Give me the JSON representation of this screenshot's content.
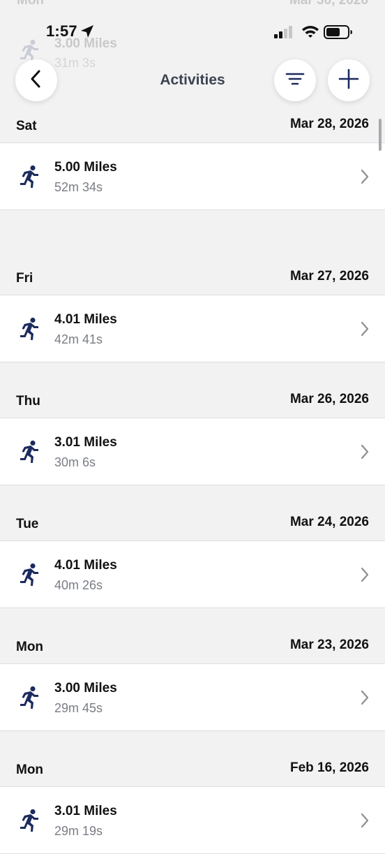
{
  "status_bar": {
    "time": "1:57"
  },
  "ghost_row": {
    "day": "Mon",
    "date": "Mar 30, 2026",
    "miles": "3.00 Miles",
    "duration": "31m 3s"
  },
  "nav": {
    "title": "Activities"
  },
  "colors": {
    "accent": "#1c2b5e",
    "background": "#f2f2f3",
    "card": "#ffffff",
    "muted_text": "#7a7d84"
  },
  "activities": [
    {
      "day": "Sat",
      "date": "Mar 28, 2026",
      "miles": "5.00 Miles",
      "duration": "52m 34s",
      "icon": "running-icon"
    },
    {
      "day": "Fri",
      "date": "Mar 27, 2026",
      "miles": "4.01 Miles",
      "duration": "42m 41s",
      "icon": "running-icon"
    },
    {
      "day": "Thu",
      "date": "Mar 26, 2026",
      "miles": "3.01 Miles",
      "duration": "30m 6s",
      "icon": "running-icon"
    },
    {
      "day": "Tue",
      "date": "Mar 24, 2026",
      "miles": "4.01 Miles",
      "duration": "40m 26s",
      "icon": "running-icon"
    },
    {
      "day": "Mon",
      "date": "Mar 23, 2026",
      "miles": "3.00 Miles",
      "duration": "29m 45s",
      "icon": "running-icon"
    },
    {
      "day": "Mon",
      "date": "Feb 16, 2026",
      "miles": "3.01 Miles",
      "duration": "29m 19s",
      "icon": "running-icon"
    }
  ]
}
